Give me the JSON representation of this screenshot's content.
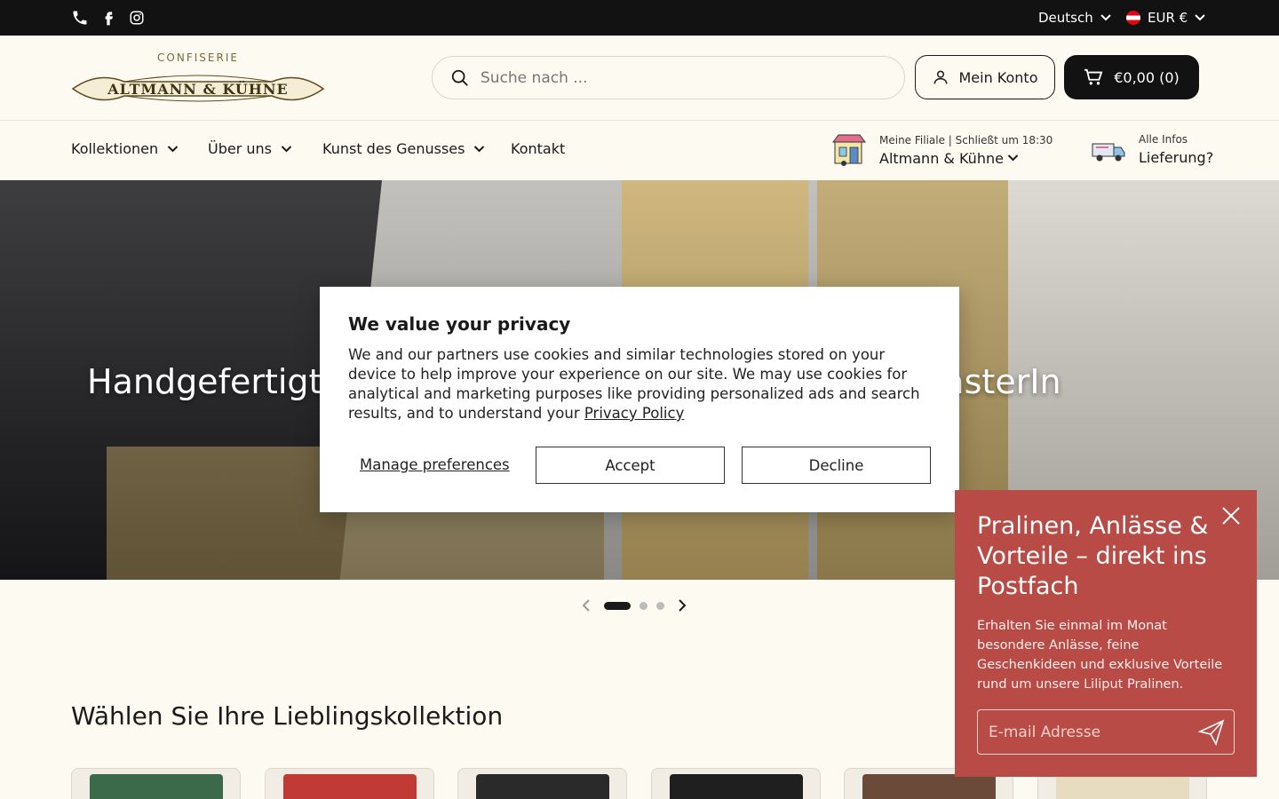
{
  "topbar": {
    "language": "Deutsch",
    "currency": "EUR €"
  },
  "header": {
    "logo_kicker": "CONFISERIE",
    "logo_name": "ALTMANN & KÜHNE",
    "search_placeholder": "Suche nach ...",
    "account_label": "Mein Konto",
    "cart_label": "€0,00 (0)"
  },
  "nav": {
    "items": [
      {
        "label": "Kollektionen"
      },
      {
        "label": "Über uns"
      },
      {
        "label": "Kunst des Genusses"
      },
      {
        "label": "Kontakt"
      }
    ],
    "store": {
      "caption": "Meine Filiale  |  Schließt um 18:30",
      "name": "Altmann & Kühne"
    },
    "delivery": {
      "caption": "Alle Infos",
      "label": "Lieferung?"
    }
  },
  "hero": {
    "title": "Handgefertigte Pralinen in wunderschönen NaschkasterIn",
    "slide_count": 3,
    "active_slide": 1
  },
  "section": {
    "title": "Wählen Sie Ihre Lieblingskollektion"
  },
  "privacy": {
    "title": "We value your privacy",
    "body": "We and our partners use cookies and similar technologies stored on your device to help improve your experience on our site. We may use cookies for analytical and marketing purposes like providing personalized ads and search results, and to understand your ",
    "policy_link": "Privacy Policy",
    "manage_label": "Manage preferences",
    "accept_label": "Accept",
    "decline_label": "Decline"
  },
  "newsletter": {
    "title": "Pralinen, Anlässe & Vorteile – direkt ins Postfach",
    "body": "Erhalten Sie einmal im Monat besondere Anlässe, feine Geschenkideen und exklusive Vorteile rund um unsere Liliput Pralinen.",
    "email_placeholder": "E-mail Adresse"
  },
  "colors": {
    "topbar": "#121212",
    "background": "#fdfaf2",
    "newsletter": "#b84b45"
  }
}
